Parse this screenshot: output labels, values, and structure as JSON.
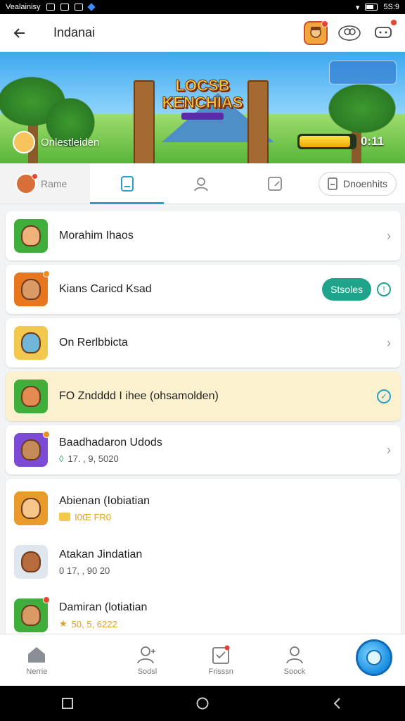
{
  "status_bar": {
    "left_text": "Vealainisy",
    "time": "5S:9"
  },
  "header": {
    "title": "Indanai"
  },
  "banner": {
    "logo_line1": "LOCSB",
    "logo_line2": "KENCHIAS",
    "user_name": "Onlestleiden",
    "progress_label": "0:11",
    "progress_fraction": 0.92
  },
  "tabs": [
    {
      "label": "Rame",
      "icon": "avatar-icon"
    },
    {
      "label": "",
      "icon": "bookmark-icon",
      "active": true
    },
    {
      "label": "",
      "icon": "person-icon"
    },
    {
      "label": "",
      "icon": "edit-square-icon"
    },
    {
      "label": "Dnoenhits",
      "icon": "note-icon"
    }
  ],
  "list": [
    {
      "title": "Morahim Ihaos",
      "thumb_bg": "#3fae3a",
      "face": "#f0b27a",
      "trailing": "chevron"
    },
    {
      "title": "Kians Caricd Ksad",
      "thumb_bg": "#e8761f",
      "face": "#d99a66",
      "trailing": "button",
      "button_label": "Stsoles"
    },
    {
      "title": "On Rerlbbicta",
      "thumb_bg": "#f2c94c",
      "face": "#6fb6d9",
      "trailing": "chevron"
    },
    {
      "title": "FO Zndddd I ihee (ohsamolden)",
      "thumb_bg": "#3fae3a",
      "face": "#e38b52",
      "trailing": "check",
      "highlight": true
    },
    {
      "title": "Baadhadaron Udods",
      "subtitle": "17. , 9, 5020",
      "sub_icon": "location-icon",
      "thumb_bg": "#7c4bd6",
      "face": "#c48a5a",
      "trailing": "chevron"
    }
  ],
  "group": [
    {
      "title": "Abienan (Iobiatian",
      "subtitle": "I0Œ FR0",
      "sub_color": "#e0a020",
      "thumb_bg": "#e89a2a",
      "face": "#f5c58a"
    },
    {
      "title": "Atakan Jindatian",
      "subtitle": "0 17, , 90 20",
      "sub_color": "#555",
      "thumb_bg": "#dfe6ee",
      "face": "#b86b3c"
    },
    {
      "title": "Damiran (lotiatian",
      "subtitle": "50, 5, 6222",
      "sub_color": "#e0a020",
      "thumb_bg": "#3fae3a",
      "face": "#d99a66"
    }
  ],
  "bottom_nav": [
    {
      "label": "Nerrie",
      "icon": "home-icon"
    },
    {
      "label": "Sodsl",
      "icon": "people-icon"
    },
    {
      "label": "Frisssn",
      "icon": "clipboard-icon"
    },
    {
      "label": "Soock",
      "icon": "user-icon"
    }
  ]
}
